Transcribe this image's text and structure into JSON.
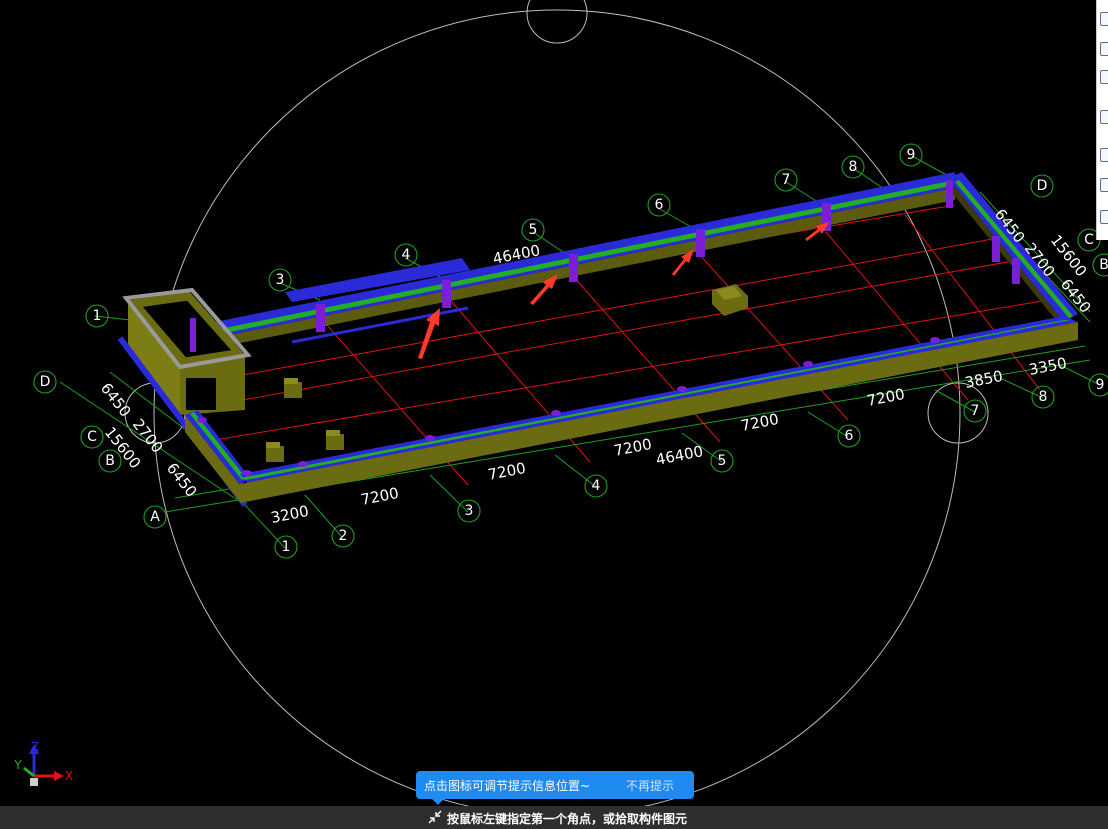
{
  "axes_top": [
    {
      "label": "1"
    },
    {
      "label": "3"
    },
    {
      "label": "4"
    },
    {
      "label": "5"
    },
    {
      "label": "6"
    },
    {
      "label": "7"
    },
    {
      "label": "8"
    },
    {
      "label": "9"
    }
  ],
  "axes_bottom": [
    {
      "label": "1"
    },
    {
      "label": "2"
    },
    {
      "label": "3"
    },
    {
      "label": "4"
    },
    {
      "label": "5"
    },
    {
      "label": "6"
    },
    {
      "label": "7"
    },
    {
      "label": "8"
    },
    {
      "label": "9"
    }
  ],
  "axes_left": [
    {
      "label": "D"
    },
    {
      "label": "C"
    },
    {
      "label": "B"
    },
    {
      "label": "A"
    }
  ],
  "axes_right": [
    {
      "label": "D"
    },
    {
      "label": "C"
    },
    {
      "label": "B"
    }
  ],
  "dims_bottom": [
    {
      "text": "3200"
    },
    {
      "text": "7200"
    },
    {
      "text": "7200"
    },
    {
      "text": "7200"
    },
    {
      "text": "7200"
    },
    {
      "text": "7200"
    },
    {
      "text": "3850"
    },
    {
      "text": "3350"
    },
    {
      "text": "46400"
    }
  ],
  "dims_top": [
    {
      "text": "46400"
    }
  ],
  "dims_left": [
    {
      "text": "6450"
    },
    {
      "text": "2700"
    },
    {
      "text": "15600"
    },
    {
      "text": "6450"
    }
  ],
  "dims_right": [
    {
      "text": "6450"
    },
    {
      "text": "2700"
    },
    {
      "text": "15600"
    },
    {
      "text": "6450"
    }
  ],
  "ucs_axes": {
    "x": "X",
    "y": "Y",
    "z": "Z"
  },
  "hint_toast": {
    "message": "点击图标可调节提示信息位置~",
    "dismiss": "不再提示"
  },
  "status_bar": {
    "icon": "collapse-arrows-icon",
    "text": "按鼠标左键指定第一个角点，或拾取构件图元"
  },
  "colors": {
    "background": "#000000",
    "grid": "#e01212",
    "axis_circle": "#1fa01f",
    "beam_top": "#2a2ad8",
    "beam_stripe": "#22b022",
    "wall": "#6b6b12",
    "column": "#7a1fd6",
    "arrow": "#ff3a2a",
    "hint": "#1f8af2",
    "status_bar": "#2e2e2e"
  }
}
